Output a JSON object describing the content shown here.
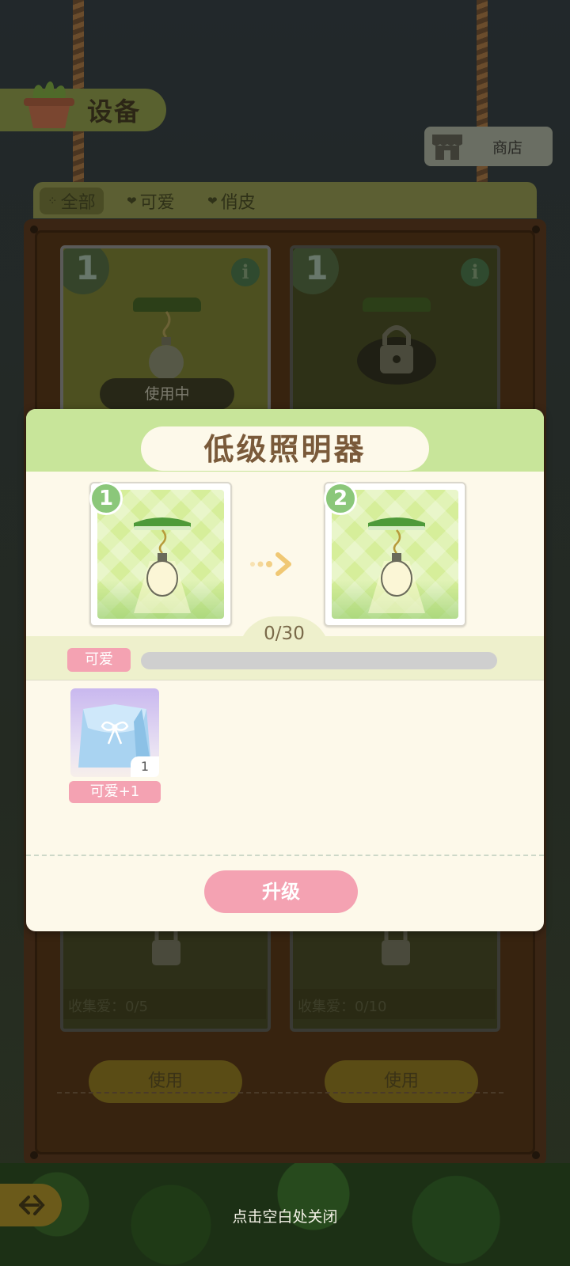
{
  "screen": {
    "title": "设备"
  },
  "shop": {
    "label": "商店"
  },
  "tabs": [
    {
      "label": "全部",
      "icon": "grid-icon",
      "active": true
    },
    {
      "label": "可爱",
      "icon": "candy-icon"
    },
    {
      "label": "俏皮",
      "icon": "candy-icon"
    }
  ],
  "equipment": {
    "cards": [
      {
        "level": "1",
        "status": "使用中",
        "locked": false
      },
      {
        "level": "1",
        "locked": true
      },
      {
        "locked": true,
        "collect": "收集爱：0/5",
        "use_label": "使用"
      },
      {
        "locked": true,
        "collect": "收集爱：0/10",
        "use_label": "使用"
      }
    ]
  },
  "modal": {
    "title": "低级照明器",
    "from_level": "1",
    "to_level": "2",
    "progress": {
      "text": "0/30",
      "current": 0,
      "target": 30,
      "stat_label": "可爱"
    },
    "reward": {
      "count": "1",
      "label": "可爱+1"
    },
    "upgrade_label": "升级"
  },
  "hint": {
    "close": "点击空白处关闭"
  },
  "colors": {
    "modal_header": "#c8e59a",
    "accent_pink": "#f4a2b2",
    "title_brown": "#7a5a3a"
  }
}
